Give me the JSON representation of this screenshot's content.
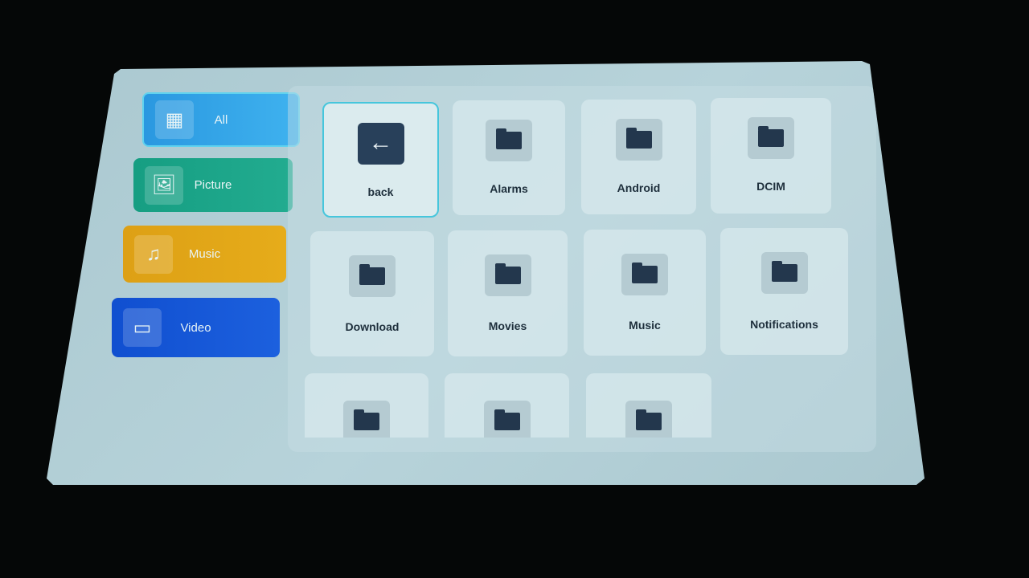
{
  "sidebar": {
    "items": [
      {
        "label": "All",
        "icon": "grid-icon",
        "color": "#2ea0e6",
        "selected": true
      },
      {
        "label": "Picture",
        "icon": "image-icon",
        "color": "#1fa287"
      },
      {
        "label": "Music",
        "icon": "music-note-icon",
        "color": "#e1a514"
      },
      {
        "label": "Video",
        "icon": "video-camera-icon",
        "color": "#1456d6"
      }
    ]
  },
  "files": [
    {
      "label": "back",
      "icon": "back-arrow-icon",
      "selected": true
    },
    {
      "label": "Alarms",
      "icon": "folder-icon"
    },
    {
      "label": "Android",
      "icon": "folder-icon"
    },
    {
      "label": "DCIM",
      "icon": "folder-icon"
    },
    {
      "label": "Download",
      "icon": "folder-icon"
    },
    {
      "label": "Movies",
      "icon": "folder-icon"
    },
    {
      "label": "Music",
      "icon": "folder-icon"
    },
    {
      "label": "Notifications",
      "icon": "folder-icon"
    },
    {
      "icon": "folder-icon"
    },
    {
      "icon": "folder-icon"
    },
    {
      "icon": "folder-icon"
    }
  ]
}
